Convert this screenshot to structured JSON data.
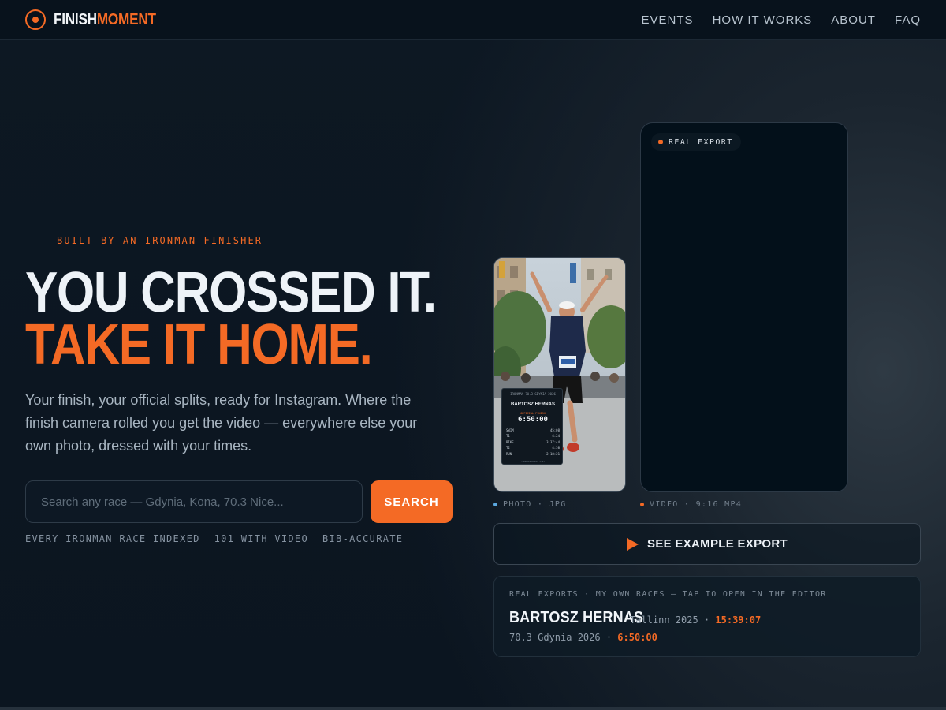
{
  "brand": {
    "part1": "FINISH",
    "part2": "MOMENT"
  },
  "nav": [
    "EVENTS",
    "HOW IT WORKS",
    "ABOUT",
    "FAQ"
  ],
  "hero": {
    "eyebrow": "BUILT BY AN IRONMAN FINISHER",
    "headline_line1": "YOU CROSSED IT.",
    "headline_line2": "TAKE IT HOME.",
    "lede": "Your finish, your official splits, ready for Instagram. Where the finish camera rolled you get the video — everywhere else your own photo, dressed with your times.",
    "search_placeholder": "Search any race — Gdynia, Kona, 70.3 Nice...",
    "search_button": "SEARCH",
    "stats": [
      "EVERY IRONMAN RACE INDEXED",
      "101 WITH VIDEO",
      "BIB-ACCURATE"
    ]
  },
  "preview": {
    "badge": "REAL EXPORT",
    "photo_caption": "PHOTO · JPG",
    "video_caption": "VIDEO · 9:16 MP4",
    "photo_overlay": {
      "race": "IRONMAN 70.3 GDYNIA 2026",
      "athlete": "BARTOSZ HERNAS",
      "label": "OFFICIAL FINISH",
      "time": "6:50:00",
      "splits": [
        {
          "leg": "SWIM",
          "time": "45:08"
        },
        {
          "leg": "T1",
          "time": "4:24"
        },
        {
          "leg": "BIKE",
          "time": "3:37:44"
        },
        {
          "leg": "T2",
          "time": "4:58"
        },
        {
          "leg": "RUN",
          "time": "2:18:21"
        }
      ],
      "footer": "FINISHMOMENT.COM"
    }
  },
  "example_button": "SEE EXAMPLE EXPORT",
  "exports": {
    "label": "REAL EXPORTS · MY OWN RACES — TAP TO OPEN IN THE EDITOR",
    "athlete": "BARTOSZ HERNAS",
    "race1": "Tallinn 2025",
    "time1": "15:39:07",
    "race2": "70.3 Gdynia 2026",
    "time2": "6:50:00",
    "separator": "·"
  },
  "colors": {
    "accent": "#f46a25",
    "background": "#0c1621",
    "photo_dot": "#5ba8e0"
  },
  "icons": {
    "logo": "target-icon",
    "play": "play-icon"
  }
}
